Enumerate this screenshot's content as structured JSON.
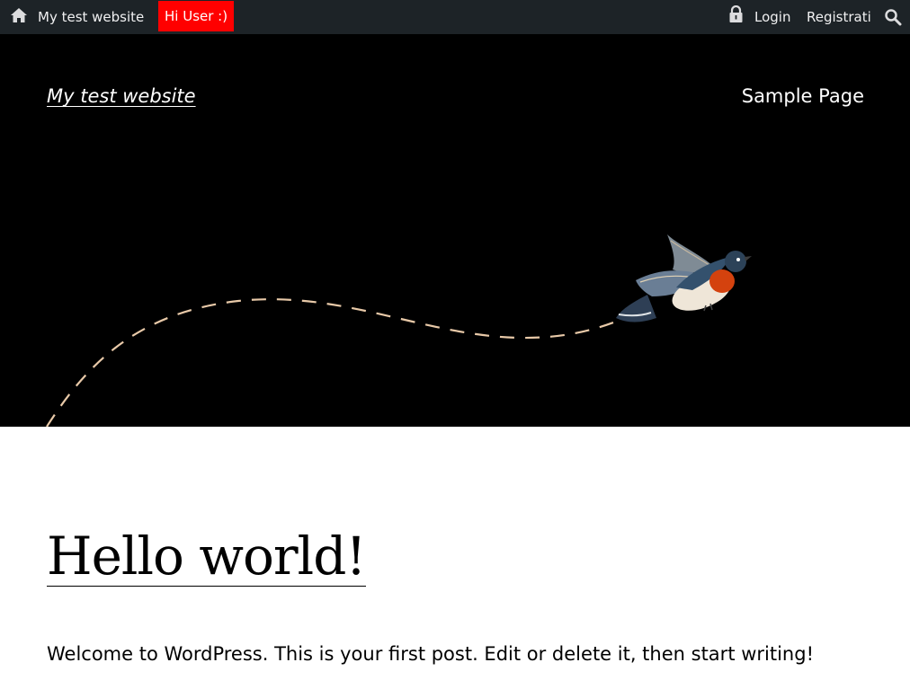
{
  "adminbar": {
    "home_icon": "home-icon",
    "site_name": "My test website",
    "greeting": "Hi User :)",
    "greeting_color": "#ff0000",
    "lock_icon": "lock-icon",
    "login_label": "Login",
    "register_label": "Registrati",
    "search_icon": "search-icon",
    "background": "#1d2327"
  },
  "header": {
    "site_title": "My test website",
    "nav_items": [
      "Sample Page"
    ],
    "background": "#000000",
    "illustration": "bird-illustration",
    "path_color": "#e8c9a8"
  },
  "post": {
    "title": "Hello world!",
    "excerpt": "Welcome to WordPress. This is your first post. Edit or delete it, then start writing!"
  }
}
